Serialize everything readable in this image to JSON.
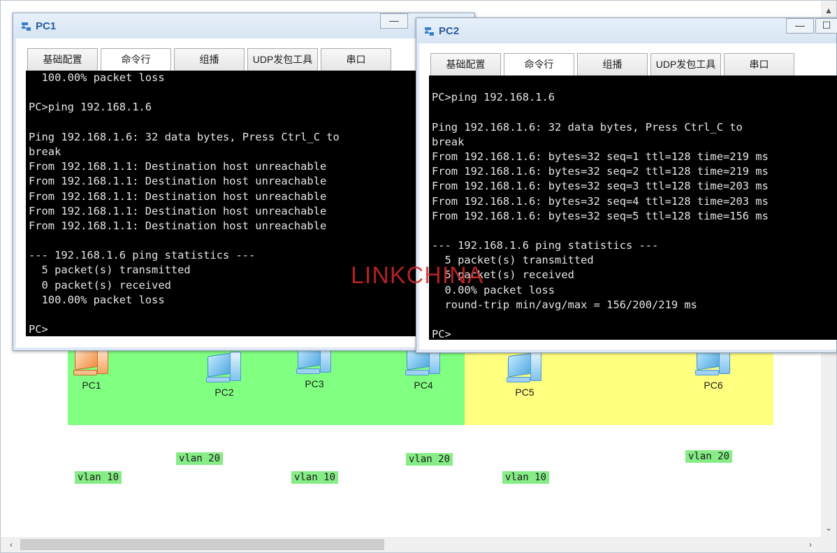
{
  "watermark": "LINKCHINA",
  "topology": {
    "pcs": [
      {
        "label": "PC1",
        "color": "orange"
      },
      {
        "label": "PC2",
        "color": "blue"
      },
      {
        "label": "PC3",
        "color": "blue"
      },
      {
        "label": "PC4",
        "color": "blue"
      },
      {
        "label": "PC5",
        "color": "blue"
      },
      {
        "label": "PC6",
        "color": "blue"
      }
    ],
    "vlan_tags": [
      "vlan 10",
      "vlan 20",
      "vlan 10",
      "vlan 20",
      "vlan 10",
      "vlan 20"
    ],
    "zone_colors": {
      "left": "#80ff80",
      "right": "#ffff80"
    }
  },
  "pc1_window": {
    "title": "PC1",
    "minimize_label": "—",
    "tabs": [
      "基础配置",
      "命令行",
      "组播",
      "UDP发包工具",
      "串口"
    ],
    "active_tab": "命令行",
    "console_lines": [
      "  100.00% packet loss",
      "",
      "PC>ping 192.168.1.6",
      "",
      "Ping 192.168.1.6: 32 data bytes, Press Ctrl_C to",
      "break",
      "From 192.168.1.1: Destination host unreachable",
      "From 192.168.1.1: Destination host unreachable",
      "From 192.168.1.1: Destination host unreachable",
      "From 192.168.1.1: Destination host unreachable",
      "From 192.168.1.1: Destination host unreachable",
      "",
      "--- 192.168.1.6 ping statistics ---",
      "  5 packet(s) transmitted",
      "  0 packet(s) received",
      "  100.00% packet loss",
      "",
      "PC>"
    ]
  },
  "pc2_window": {
    "title": "PC2",
    "minimize_label": "—",
    "maximize_label": "☐",
    "tabs": [
      "基础配置",
      "命令行",
      "组播",
      "UDP发包工具",
      "串口"
    ],
    "active_tab": "命令行",
    "console_lines": [
      "",
      "PC>ping 192.168.1.6",
      "",
      "Ping 192.168.1.6: 32 data bytes, Press Ctrl_C to",
      "break",
      "From 192.168.1.6: bytes=32 seq=1 ttl=128 time=219 ms",
      "From 192.168.1.6: bytes=32 seq=2 ttl=128 time=219 ms",
      "From 192.168.1.6: bytes=32 seq=3 ttl=128 time=203 ms",
      "From 192.168.1.6: bytes=32 seq=4 ttl=128 time=203 ms",
      "From 192.168.1.6: bytes=32 seq=5 ttl=128 time=156 ms",
      "",
      "--- 192.168.1.6 ping statistics ---",
      "  5 packet(s) transmitted",
      "  5 packet(s) received",
      "  0.00% packet loss",
      "  round-trip min/avg/max = 156/200/219 ms",
      "",
      "PC>"
    ]
  },
  "scrollbars": {
    "up": "▲",
    "down": "⌄",
    "left": "‹",
    "right": "›"
  }
}
